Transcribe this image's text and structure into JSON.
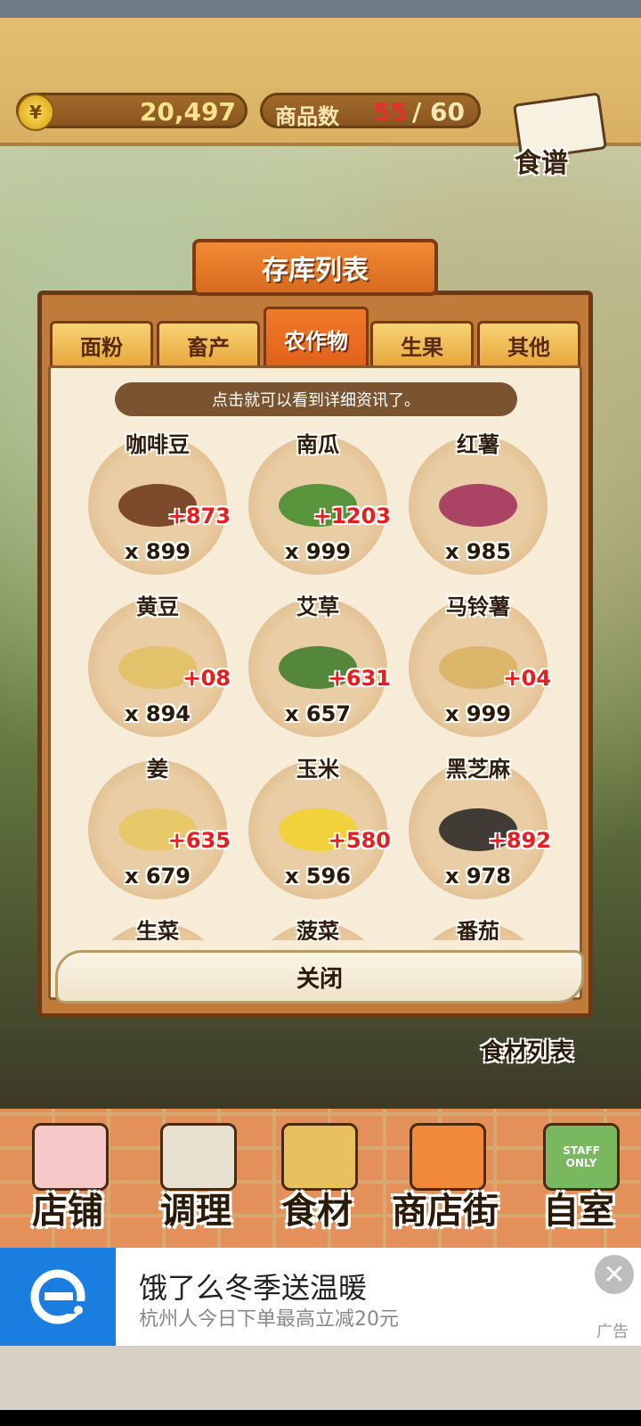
{
  "header": {
    "coins": "20,497",
    "coin_symbol": "¥",
    "goods_label": "商品数",
    "goods_current": "55",
    "goods_separator": "/",
    "goods_max": "60",
    "recipe_label": "食谱"
  },
  "panel": {
    "title": "存库列表",
    "tabs": [
      {
        "label": "面粉",
        "active": false
      },
      {
        "label": "畜产",
        "active": false
      },
      {
        "label": "农作物",
        "active": true
      },
      {
        "label": "生果",
        "active": false
      },
      {
        "label": "其他",
        "active": false
      }
    ],
    "hint": "点击就可以看到详细资讯了。",
    "items": [
      {
        "name": "咖啡豆",
        "add": "+873",
        "qty": "x 899",
        "icon": "coffee-beans-icon"
      },
      {
        "name": "南瓜",
        "add": "+1203",
        "qty": "x 999",
        "icon": "pumpkin-icon"
      },
      {
        "name": "红薯",
        "add": "",
        "qty": "x 985",
        "icon": "sweet-potato-icon"
      },
      {
        "name": "黄豆",
        "add": "+08",
        "qty": "x 894",
        "icon": "soybean-icon"
      },
      {
        "name": "艾草",
        "add": "+631",
        "qty": "x 657",
        "icon": "mugwort-icon"
      },
      {
        "name": "马铃薯",
        "add": "+04",
        "qty": "x 999",
        "icon": "potato-icon"
      },
      {
        "name": "姜",
        "add": "+635",
        "qty": "x 679",
        "icon": "ginger-icon"
      },
      {
        "name": "玉米",
        "add": "+580",
        "qty": "x 596",
        "icon": "corn-icon"
      },
      {
        "name": "黑芝麻",
        "add": "+892",
        "qty": "x 978",
        "icon": "black-sesame-icon"
      },
      {
        "name": "生菜",
        "add": "",
        "qty": "",
        "icon": "lettuce-icon"
      },
      {
        "name": "菠菜",
        "add": "",
        "qty": "",
        "icon": "spinach-icon"
      },
      {
        "name": "番茄",
        "add": "",
        "qty": "",
        "icon": "tomato-icon"
      }
    ],
    "close_label": "关闭",
    "food_list_label": "食材列表"
  },
  "nav": [
    {
      "label": "店铺",
      "icon": "cake-icon"
    },
    {
      "label": "调理",
      "icon": "mixing-bowl-icon"
    },
    {
      "label": "食材",
      "icon": "flour-sack-icon"
    },
    {
      "label": "商店街",
      "icon": "shop-street-icon"
    },
    {
      "label": "自室",
      "icon": "staff-only-door-icon"
    }
  ],
  "nav_icon_text": "STAFF ONLY",
  "ad": {
    "title": "饿了么冬季送温暖",
    "subtitle": "杭州人今日下单最高立减20元",
    "tag": "广告",
    "close_glyph": "✕"
  }
}
